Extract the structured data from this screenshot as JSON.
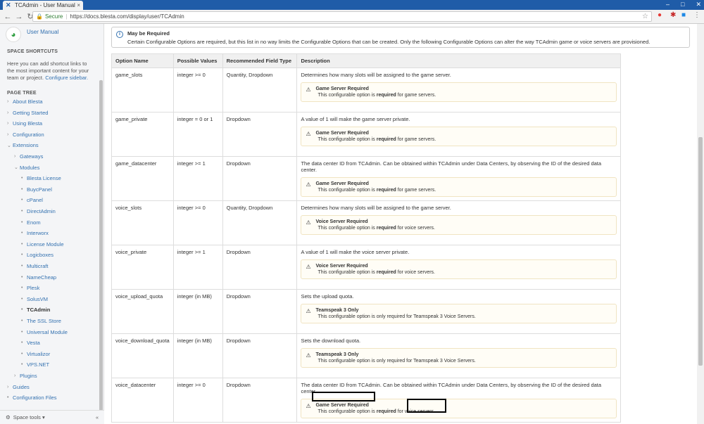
{
  "browser": {
    "tab_title": "TCAdmin - User Manual",
    "secure_label": "Secure",
    "url": "https://docs.blesta.com/display/user/TCAdmin"
  },
  "sidebar": {
    "space_name": "User Manual",
    "shortcuts_heading": "SPACE SHORTCUTS",
    "shortcuts_text": "Here you can add shortcut links to the most important content for your team or project.",
    "shortcuts_link": "Configure sidebar.",
    "tree_heading": "PAGE TREE",
    "tree": [
      {
        "label": "About Blesta",
        "type": "chev"
      },
      {
        "label": "Getting Started",
        "type": "chev"
      },
      {
        "label": "Using Blesta",
        "type": "chev"
      },
      {
        "label": "Configuration",
        "type": "chev"
      },
      {
        "label": "Extensions",
        "type": "open"
      },
      {
        "label": "Gateways",
        "type": "chev"
      },
      {
        "label": "Modules",
        "type": "open"
      },
      {
        "label": "Blesta License",
        "type": "bullet"
      },
      {
        "label": "BuycPanel",
        "type": "bullet"
      },
      {
        "label": "cPanel",
        "type": "bullet"
      },
      {
        "label": "DirectAdmin",
        "type": "bullet"
      },
      {
        "label": "Enom",
        "type": "bullet"
      },
      {
        "label": "Interworx",
        "type": "bullet"
      },
      {
        "label": "License Module",
        "type": "bullet"
      },
      {
        "label": "Logicboxes",
        "type": "bullet"
      },
      {
        "label": "Multicraft",
        "type": "bullet"
      },
      {
        "label": "NameCheap",
        "type": "bullet"
      },
      {
        "label": "Plesk",
        "type": "bullet"
      },
      {
        "label": "SolusVM",
        "type": "bullet"
      },
      {
        "label": "TCAdmin",
        "type": "current"
      },
      {
        "label": "The SSL Store",
        "type": "bullet"
      },
      {
        "label": "Universal Module",
        "type": "bullet"
      },
      {
        "label": "Vesta",
        "type": "bullet"
      },
      {
        "label": "Virtualizor",
        "type": "bullet"
      },
      {
        "label": "VPS.NET",
        "type": "bullet"
      },
      {
        "label": "Plugins",
        "type": "chev"
      },
      {
        "label": "Guides",
        "type": "chev"
      },
      {
        "label": "Configuration Files",
        "type": "bullet"
      }
    ],
    "footer_label": "Space tools"
  },
  "info": {
    "title": "May be Required",
    "body": "Certain Configurable Options are required, but this list in no way limits the Configurable Options that can be created. Only the following Configurable Options can alter the way TCAdmin game or voice servers are provisioned."
  },
  "table": {
    "headers": [
      "Option Name",
      "Possible Values",
      "Recommended Field Type",
      "Description"
    ],
    "rows": [
      {
        "name": "game_slots",
        "values": "integer >= 0",
        "field": "Quantity, Dropdown",
        "desc": "Determines how many slots will be assigned to the game server.",
        "warn_title": "Game Server Required",
        "warn_pre": "This configurable option is ",
        "warn_bold": "required",
        "warn_post": " for game servers."
      },
      {
        "name": "game_private",
        "values": "integer = 0 or 1",
        "field": "Dropdown",
        "desc": "A value of 1 will make the game server private.",
        "warn_title": "Game Server Required",
        "warn_pre": "This configurable option is ",
        "warn_bold": "required",
        "warn_post": " for game servers."
      },
      {
        "name": "game_datacenter",
        "values": "integer >= 1",
        "field": "Dropdown",
        "desc": "The data center ID from TCAdmin. Can be obtained within TCAdmin under Data Centers, by observing the ID of the desired data center.",
        "warn_title": "Game Server Required",
        "warn_pre": "This configurable option is ",
        "warn_bold": "required",
        "warn_post": " for game servers."
      },
      {
        "name": "voice_slots",
        "values": "integer >= 0",
        "field": "Quantity, Dropdown",
        "desc": "Determines how many slots will be assigned to the game server.",
        "warn_title": "Voice Server Required",
        "warn_pre": "This configurable option is ",
        "warn_bold": "required",
        "warn_post": " for voice servers."
      },
      {
        "name": "voice_private",
        "values": "integer >= 1",
        "field": "Dropdown",
        "desc": "A value of 1 will make the voice server private.",
        "warn_title": "Voice Server Required",
        "warn_pre": "This configurable option is ",
        "warn_bold": "required",
        "warn_post": " for voice servers."
      },
      {
        "name": "voice_upload_quota",
        "values": "integer (in MB)",
        "field": "Dropdown",
        "desc": "Sets the upload quota.",
        "warn_title": "Teamspeak 3 Only",
        "warn_pre": "This configurable option is only required for Teamspeak 3 Voice Servers.",
        "warn_bold": "",
        "warn_post": ""
      },
      {
        "name": "voice_download_quota",
        "values": "integer (in MB)",
        "field": "Dropdown",
        "desc": "Sets the download quota.",
        "warn_title": "Teamspeak 3 Only",
        "warn_pre": "This configurable option is only required for Teamspeak 3 Voice Servers.",
        "warn_bold": "",
        "warn_post": ""
      },
      {
        "name": "voice_datacenter",
        "values": "integer >= 0",
        "field": "Dropdown",
        "desc": "The data center ID from TCAdmin. Can be obtained within TCAdmin under Data Centers, by observing the ID of the desired data center.",
        "warn_title": "Game Server Required",
        "warn_pre": "This configurable option is ",
        "warn_bold": "required",
        "warn_post": " for voice servers."
      }
    ]
  }
}
